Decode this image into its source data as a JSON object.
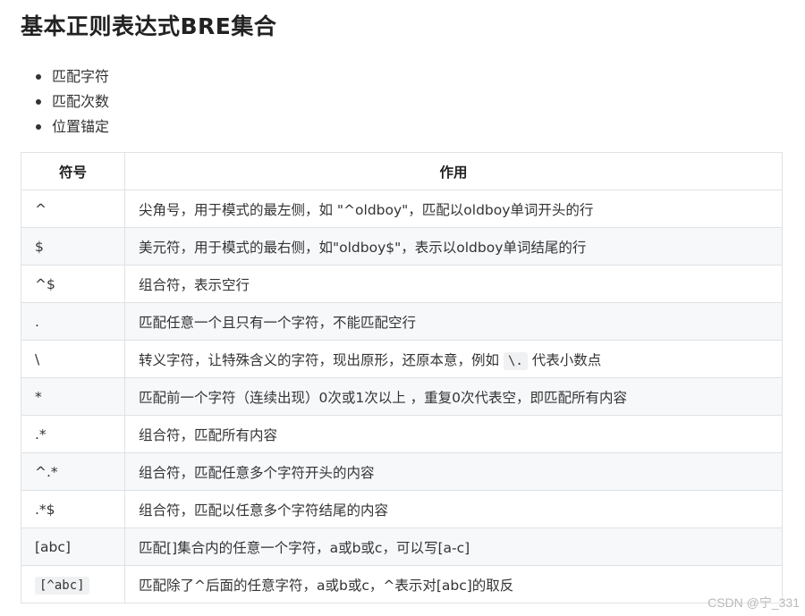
{
  "title": "基本正则表达式BRE集合",
  "bullets": [
    "匹配字符",
    "匹配次数",
    "位置锚定"
  ],
  "table": {
    "headers": [
      "符号",
      "作用"
    ],
    "rows": [
      {
        "symbol": "^",
        "desc": "尖角号，用于模式的最左侧，如 \"^oldboy\"，匹配以oldboy单词开头的行"
      },
      {
        "symbol": "$",
        "desc": "美元符，用于模式的最右侧，如\"oldboy$\"，表示以oldboy单词结尾的行"
      },
      {
        "symbol": "^$",
        "desc": "组合符，表示空行"
      },
      {
        "symbol": ".",
        "desc": "匹配任意一个且只有一个字符，不能匹配空行"
      },
      {
        "symbol": "\\",
        "desc_before": "转义字符，让特殊含义的字符，现出原形，还原本意，例如 ",
        "desc_code": "\\.",
        "desc_after": " 代表小数点"
      },
      {
        "symbol": "*",
        "desc": "匹配前一个字符（连续出现）0次或1次以上 ，重复0次代表空，即匹配所有内容"
      },
      {
        "symbol": ".*",
        "desc": "组合符，匹配所有内容"
      },
      {
        "symbol": "^.*",
        "desc": "组合符，匹配任意多个字符开头的内容"
      },
      {
        "symbol": ".*$",
        "desc": "组合符，匹配以任意多个字符结尾的内容"
      },
      {
        "symbol": "[abc]",
        "desc": "匹配[]集合内的任意一个字符，a或b或c，可以写[a-c]"
      },
      {
        "symbol_code": "[^abc]",
        "desc": "匹配除了^后面的任意字符，a或b或c，^表示对[abc]的取反"
      }
    ]
  },
  "watermark": "CSDN @宁_331"
}
